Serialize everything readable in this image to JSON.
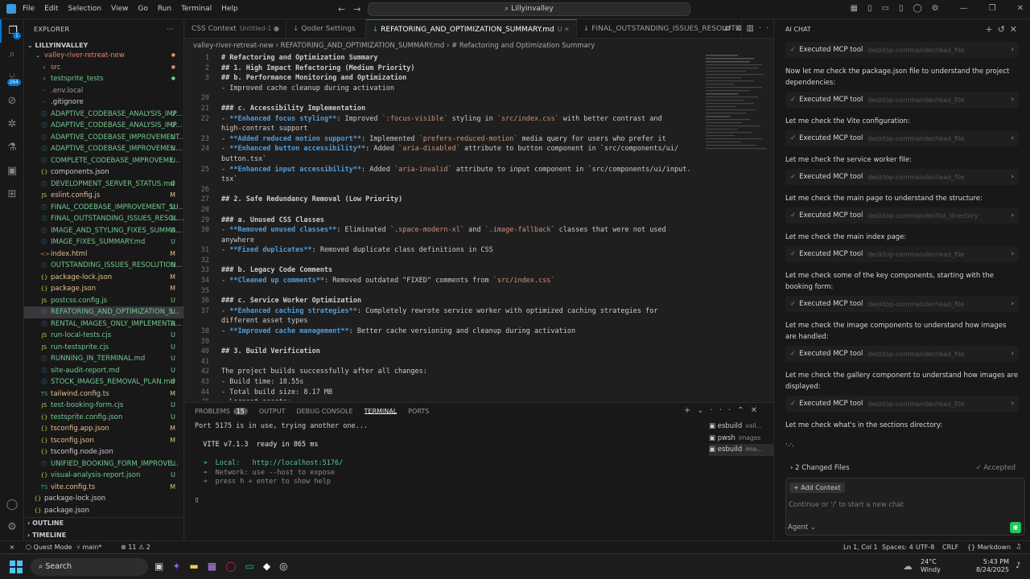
{
  "titlebar": {
    "menu": [
      "File",
      "Edit",
      "Selection",
      "View",
      "Go",
      "Run",
      "Terminal",
      "Help"
    ],
    "search_text": "Lillyinvalley"
  },
  "activity": {
    "badge_scm": "1",
    "badge_ext": "264"
  },
  "explorer": {
    "header": "EXPLORER",
    "root": "LILLYINVALLEY",
    "items": [
      {
        "label": "valley-river-retreat-new",
        "status": "",
        "color": "#e8846b",
        "indent": 12,
        "icon": "chevron-down",
        "kind": "folder"
      },
      {
        "label": "src",
        "status": "",
        "color": "#e8846b",
        "indent": 20,
        "icon": "chevron-right",
        "kind": "folder"
      },
      {
        "label": "testsprite_tests",
        "status": "",
        "color": "#73c991",
        "indent": 20,
        "icon": "chevron-right",
        "kind": "folder"
      },
      {
        "label": ".env.local",
        "status": "",
        "color": "#9d9d9d",
        "indent": 20,
        "icon": "",
        "kind": "file"
      },
      {
        "label": ".gitignore",
        "status": "",
        "color": "#ccc",
        "indent": 20,
        "icon": "",
        "kind": "file"
      },
      {
        "label": "ADAPTIVE_CODEBASE_ANALYSIS_IMP...",
        "status": "U",
        "color": "#73c991",
        "indent": 20,
        "icon": "md",
        "kind": "md"
      },
      {
        "label": "ADAPTIVE_CODEBASE_ANALYSIS_IMP...",
        "status": "U",
        "color": "#73c991",
        "indent": 20,
        "icon": "md",
        "kind": "md"
      },
      {
        "label": "ADAPTIVE_CODEBASE_IMPROVEMENT...",
        "status": "U",
        "color": "#73c991",
        "indent": 20,
        "icon": "md",
        "kind": "md"
      },
      {
        "label": "ADAPTIVE_CODEBASE_IMPROVEMEN...",
        "status": "U",
        "color": "#73c991",
        "indent": 20,
        "icon": "md",
        "kind": "md"
      },
      {
        "label": "COMPLETE_CODEBASE_IMPROVEME...",
        "status": "U",
        "color": "#73c991",
        "indent": 20,
        "icon": "md",
        "kind": "md"
      },
      {
        "label": "components.json",
        "status": "",
        "color": "#ccc",
        "indent": 20,
        "icon": "json",
        "kind": "json"
      },
      {
        "label": "DEVELOPMENT_SERVER_STATUS.md",
        "status": "U",
        "color": "#73c991",
        "indent": 20,
        "icon": "md",
        "kind": "md"
      },
      {
        "label": "eslint.config.js",
        "status": "M",
        "color": "#e2c08d",
        "indent": 20,
        "icon": "js",
        "kind": "js"
      },
      {
        "label": "FINAL_CODEBASE_IMPROVEMENT_SU...",
        "status": "U",
        "color": "#73c991",
        "indent": 20,
        "icon": "md",
        "kind": "md"
      },
      {
        "label": "FINAL_OUTSTANDING_ISSUES_RESOL...",
        "status": "U",
        "color": "#73c991",
        "indent": 20,
        "icon": "md",
        "kind": "md"
      },
      {
        "label": "IMAGE_AND_STYLING_FIXES_SUMMA...",
        "status": "U",
        "color": "#73c991",
        "indent": 20,
        "icon": "md",
        "kind": "md"
      },
      {
        "label": "IMAGE_FIXES_SUMMARY.md",
        "status": "U",
        "color": "#73c991",
        "indent": 20,
        "icon": "md",
        "kind": "md"
      },
      {
        "label": "index.html",
        "status": "M",
        "color": "#e2c08d",
        "indent": 20,
        "icon": "html",
        "kind": "html"
      },
      {
        "label": "OUTSTANDING_ISSUES_RESOLUTION...",
        "status": "U",
        "color": "#73c991",
        "indent": 20,
        "icon": "md",
        "kind": "md"
      },
      {
        "label": "package-lock.json",
        "status": "M",
        "color": "#e2c08d",
        "indent": 20,
        "icon": "json",
        "kind": "json"
      },
      {
        "label": "package.json",
        "status": "M",
        "color": "#e2c08d",
        "indent": 20,
        "icon": "json",
        "kind": "json"
      },
      {
        "label": "postcss.config.js",
        "status": "U",
        "color": "#73c991",
        "indent": 20,
        "icon": "js",
        "kind": "js"
      },
      {
        "label": "REFATORING_AND_OPTIMIZATION_S...",
        "status": "U",
        "color": "#73c991",
        "indent": 20,
        "icon": "md",
        "kind": "md",
        "selected": true
      },
      {
        "label": "RENTAL_IMAGES_ONLY_IMPLEMENTA...",
        "status": "U",
        "color": "#73c991",
        "indent": 20,
        "icon": "md",
        "kind": "md"
      },
      {
        "label": "run-local-tests.cjs",
        "status": "U",
        "color": "#73c991",
        "indent": 20,
        "icon": "js",
        "kind": "js"
      },
      {
        "label": "run-testsprite.cjs",
        "status": "U",
        "color": "#73c991",
        "indent": 20,
        "icon": "js",
        "kind": "js"
      },
      {
        "label": "RUNNING_IN_TERMINAL.md",
        "status": "U",
        "color": "#73c991",
        "indent": 20,
        "icon": "md",
        "kind": "md"
      },
      {
        "label": "site-audit-report.md",
        "status": "U",
        "color": "#73c991",
        "indent": 20,
        "icon": "md",
        "kind": "md"
      },
      {
        "label": "STOCK_IMAGES_REMOVAL_PLAN.md",
        "status": "U",
        "color": "#73c991",
        "indent": 20,
        "icon": "md",
        "kind": "md"
      },
      {
        "label": "tailwind.config.ts",
        "status": "M",
        "color": "#e2c08d",
        "indent": 20,
        "icon": "ts",
        "kind": "ts"
      },
      {
        "label": "test-booking-form.cjs",
        "status": "U",
        "color": "#73c991",
        "indent": 20,
        "icon": "js",
        "kind": "js"
      },
      {
        "label": "testsprite.config.json",
        "status": "U",
        "color": "#73c991",
        "indent": 20,
        "icon": "json",
        "kind": "json"
      },
      {
        "label": "tsconfig.app.json",
        "status": "M",
        "color": "#e2c08d",
        "indent": 20,
        "icon": "json",
        "kind": "json"
      },
      {
        "label": "tsconfig.json",
        "status": "M",
        "color": "#e2c08d",
        "indent": 20,
        "icon": "json",
        "kind": "json"
      },
      {
        "label": "tsconfig.node.json",
        "status": "",
        "color": "#ccc",
        "indent": 20,
        "icon": "json",
        "kind": "json"
      },
      {
        "label": "UNIFIED_BOOKING_FORM_IMPROVE...",
        "status": "U",
        "color": "#73c991",
        "indent": 20,
        "icon": "md",
        "kind": "md"
      },
      {
        "label": "visual-analysis-report.json",
        "status": "U",
        "color": "#73c991",
        "indent": 20,
        "icon": "json",
        "kind": "json"
      },
      {
        "label": "vite.config.ts",
        "status": "M",
        "color": "#e2c08d",
        "indent": 20,
        "icon": "ts",
        "kind": "ts"
      },
      {
        "label": "package-lock.json",
        "status": "",
        "color": "#ccc",
        "indent": 12,
        "icon": "json",
        "kind": "json"
      },
      {
        "label": "package.json",
        "status": "",
        "color": "#ccc",
        "indent": 12,
        "icon": "json",
        "kind": "json"
      }
    ],
    "outline": "OUTLINE",
    "timeline": "TIMELINE"
  },
  "tabs": [
    {
      "label": "CSS Context",
      "sub": "Untitled-1 ●",
      "active": false
    },
    {
      "label": "Qoder Settings",
      "sub": "",
      "active": false
    },
    {
      "label": "REFATORING_AND_OPTIMIZATION_SUMMARY.md",
      "sub": "U ✕",
      "active": true
    },
    {
      "label": "FINAL_OUTSTANDING_ISSUES_RESOLUTION.r",
      "sub": "",
      "active": false
    }
  ],
  "breadcrumb": "valley-river-retreat-new  ›  REFATORING_AND_OPTIMIZATION_SUMMARY.md  ›  # Refactoring and Optimization Summary",
  "editor_lines": [
    {
      "n": "1",
      "t": "# Refactoring and Optimization Summary",
      "c": "h"
    },
    {
      "n": "2",
      "t": "## 1. High Impact Refactoring (Medium Priority)",
      "c": "h"
    },
    {
      "n": "3",
      "t": "## b. Performance Monitoring and Optimization",
      "c": "h"
    },
    {
      "n": "",
      "t": "- Improved cache cleanup during activation",
      "c": ""
    },
    {
      "n": "20",
      "t": "",
      "c": ""
    },
    {
      "n": "21",
      "t": "### c. Accessibility Implementation",
      "c": "h"
    },
    {
      "n": "22",
      "t": "- **Enhanced focus styling**: Improved `:focus-visible` styling in `src/index.css` with better contrast and",
      "c": ""
    },
    {
      "n": "",
      "t": "high-contrast support",
      "c": ""
    },
    {
      "n": "23",
      "t": "- **Added reduced motion support**: Implemented `prefers-reduced-motion` media query for users who prefer it",
      "c": ""
    },
    {
      "n": "24",
      "t": "- **Enhanced button accessibility**: Added `aria-disabled` attribute to button component in `src/components/ui/",
      "c": ""
    },
    {
      "n": "",
      "t": "button.tsx`",
      "c": ""
    },
    {
      "n": "25",
      "t": "- **Enhanced input accessibility**: Added `aria-invalid` attribute to input component in `src/components/ui/input.",
      "c": ""
    },
    {
      "n": "",
      "t": "tsx`",
      "c": ""
    },
    {
      "n": "26",
      "t": "",
      "c": ""
    },
    {
      "n": "27",
      "t": "## 2. Safe Redundancy Removal (Low Priority)",
      "c": "h"
    },
    {
      "n": "28",
      "t": "",
      "c": ""
    },
    {
      "n": "29",
      "t": "### a. Unused CSS Classes",
      "c": "h"
    },
    {
      "n": "30",
      "t": "- **Removed unused classes**: Eliminated `.space-modern-xl` and `.image-fallback` classes that were not used",
      "c": ""
    },
    {
      "n": "",
      "t": "anywhere",
      "c": ""
    },
    {
      "n": "31",
      "t": "- **Fixed duplicates**: Removed duplicate class definitions in CSS",
      "c": ""
    },
    {
      "n": "32",
      "t": "",
      "c": ""
    },
    {
      "n": "33",
      "t": "### b. Legacy Code Comments",
      "c": "h"
    },
    {
      "n": "34",
      "t": "- **Cleaned up comments**: Removed outdated \"FIXED\" comments from `src/index.css`",
      "c": ""
    },
    {
      "n": "35",
      "t": "",
      "c": ""
    },
    {
      "n": "36",
      "t": "### c. Service Worker Optimization",
      "c": "h"
    },
    {
      "n": "37",
      "t": "- **Enhanced caching strategies**: Completely rewrote service worker with optimized caching strategies for",
      "c": ""
    },
    {
      "n": "",
      "t": "different asset types",
      "c": ""
    },
    {
      "n": "38",
      "t": "- **Improved cache management**: Better cache versioning and cleanup during activation",
      "c": ""
    },
    {
      "n": "39",
      "t": "",
      "c": ""
    },
    {
      "n": "40",
      "t": "## 3. Build Verification",
      "c": "h"
    },
    {
      "n": "41",
      "t": "",
      "c": ""
    },
    {
      "n": "42",
      "t": "The project builds successfully after all changes:",
      "c": ""
    },
    {
      "n": "43",
      "t": "- Build time: 18.55s",
      "c": ""
    },
    {
      "n": "44",
      "t": "- Total build size: 8.17 MB",
      "c": ""
    },
    {
      "n": "45",
      "t": "- Largest assets:",
      "c": ""
    }
  ],
  "panel": {
    "tabs": [
      "PROBLEMS",
      "OUTPUT",
      "DEBUG CONSOLE",
      "TERMINAL",
      "PORTS"
    ],
    "problems_count": "15",
    "terminal_lines": [
      "Port 5175 is in use, trying another one...",
      "",
      "  VITE v7.1.3  ready in 865 ms",
      "",
      "  ➜  Local:   http://localhost:5176/",
      "  ➜  Network: use --host to expose",
      "  ➜  press h + enter to show help",
      "",
      "▯"
    ],
    "terminals": [
      {
        "name": "esbuild",
        "sub": "vall..."
      },
      {
        "name": "pwsh",
        "sub": "images"
      },
      {
        "name": "esbuild",
        "sub": "ima..."
      }
    ]
  },
  "chat": {
    "title": "AI CHAT",
    "items": [
      {
        "type": "tool",
        "label": "Executed MCP tool",
        "path": "desktop-commander/read_file"
      },
      {
        "type": "msg",
        "text": "Now let me check the package.json file to understand the project dependencies:"
      },
      {
        "type": "tool",
        "label": "Executed MCP tool",
        "path": "desktop-commander/read_file"
      },
      {
        "type": "msg",
        "text": "Let me check the Vite configuration:"
      },
      {
        "type": "tool",
        "label": "Executed MCP tool",
        "path": "desktop-commander/read_file"
      },
      {
        "type": "msg",
        "text": "Let me check the service worker file:"
      },
      {
        "type": "tool",
        "label": "Executed MCP tool",
        "path": "desktop-commander/read_file"
      },
      {
        "type": "msg",
        "text": "Let me check the main page to understand the structure:"
      },
      {
        "type": "tool",
        "label": "Executed MCP tool",
        "path": "desktop-commander/list_directory"
      },
      {
        "type": "msg",
        "text": "Let me check the main index page:"
      },
      {
        "type": "tool",
        "label": "Executed MCP tool",
        "path": "desktop-commander/read_file"
      },
      {
        "type": "msg",
        "text": "Let me check some of the key components, starting with the booking form:"
      },
      {
        "type": "tool",
        "label": "Executed MCP tool",
        "path": "desktop-commander/read_file"
      },
      {
        "type": "msg",
        "text": "Let me check the image components to understand how images are handled:"
      },
      {
        "type": "tool",
        "label": "Executed MCP tool",
        "path": "desktop-commander/read_file"
      },
      {
        "type": "msg",
        "text": "Let me check the gallery component to understand how images are displayed:"
      },
      {
        "type": "tool",
        "label": "Executed MCP tool",
        "path": "desktop-commander/read_file"
      },
      {
        "type": "msg",
        "text": "Let me check what's in the sections directory:"
      },
      {
        "type": "msg",
        "text": "·.·."
      }
    ],
    "changed_files": "2 Changed Files",
    "accepted": "Accepted",
    "add_context": "+ Add Context",
    "input_placeholder": "Continue or '/' to start a new chat",
    "mode": "Agent"
  },
  "status": {
    "quest_mode": "Quest Mode",
    "branch": "main*",
    "errors": "11",
    "warnings": "2",
    "position": "Ln 1, Col 1",
    "spaces": "Spaces: 4",
    "encoding": "UTF-8",
    "eol": "CRLF",
    "language": "Markdown"
  },
  "taskbar": {
    "search": "Search",
    "temp": "24°C",
    "weather": "Windy",
    "time": "5:43 PM",
    "date": "8/24/2025"
  }
}
